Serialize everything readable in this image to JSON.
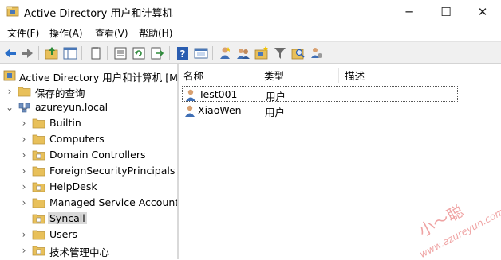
{
  "window": {
    "title": "Active Directory 用户和计算机",
    "minimize": "─",
    "maximize": "☐",
    "close": "✕"
  },
  "menu": {
    "items": [
      {
        "label": "文件(F)"
      },
      {
        "label": "操作(A)"
      },
      {
        "label": "查看(V)"
      },
      {
        "label": "帮助(H)"
      }
    ]
  },
  "toolbar": {
    "icons": [
      "back-icon",
      "forward-icon",
      "up-folder-icon",
      "show-hide-tree-icon",
      "copy-icon",
      "properties-icon",
      "refresh-icon",
      "export-list-icon",
      "help-icon",
      "console-view-icon",
      "new-user-icon",
      "new-group-icon",
      "new-ou-icon",
      "filter-icon",
      "find-icon",
      "add-to-group-icon"
    ]
  },
  "tree": {
    "root": "Active Directory 用户和计算机 [Ma",
    "saved_queries": "保存的查询",
    "domain": "azureyun.local",
    "children": [
      {
        "label": "Builtin"
      },
      {
        "label": "Computers"
      },
      {
        "label": "Domain Controllers"
      },
      {
        "label": "ForeignSecurityPrincipals"
      },
      {
        "label": "HelpDesk"
      },
      {
        "label": "Managed Service Accounts"
      },
      {
        "label": "Syncall"
      },
      {
        "label": "Users"
      },
      {
        "label": "技术管理中心"
      }
    ],
    "selected": "Syncall"
  },
  "list": {
    "columns": {
      "name": "名称",
      "type": "类型",
      "desc": "描述"
    },
    "rows": [
      {
        "name": "Test001",
        "type": "用户",
        "desc": ""
      },
      {
        "name": "XiaoWen",
        "type": "用户",
        "desc": ""
      }
    ]
  },
  "watermark": {
    "cn": "小～聪",
    "url": "www.azureyun.com"
  },
  "colors": {
    "folder": "#e8c05a",
    "selection": "#d9d9d9",
    "toolbar_bg": "#f0f0f0"
  }
}
